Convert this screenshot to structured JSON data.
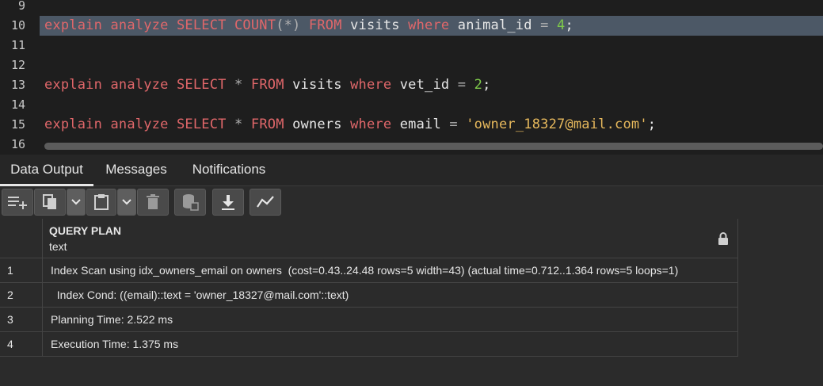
{
  "editor": {
    "lines": [
      {
        "n": "9",
        "tokens": []
      },
      {
        "n": "10",
        "highlighted": true,
        "tokens": [
          {
            "t": "explain analyze SELECT COUNT",
            "c": "kw"
          },
          {
            "t": "(*)",
            "c": "op"
          },
          {
            "t": " FROM ",
            "c": "kw"
          },
          {
            "t": "visits ",
            "c": ""
          },
          {
            "t": "where ",
            "c": "kw"
          },
          {
            "t": "animal_id ",
            "c": ""
          },
          {
            "t": "= ",
            "c": "op"
          },
          {
            "t": "4",
            "c": "num"
          },
          {
            "t": ";",
            "c": ""
          }
        ]
      },
      {
        "n": "11",
        "tokens": []
      },
      {
        "n": "12",
        "tokens": []
      },
      {
        "n": "13",
        "tokens": [
          {
            "t": "explain analyze SELECT ",
            "c": "kw"
          },
          {
            "t": "* ",
            "c": "op"
          },
          {
            "t": "FROM ",
            "c": "kw"
          },
          {
            "t": "visits ",
            "c": ""
          },
          {
            "t": "where ",
            "c": "kw"
          },
          {
            "t": "vet_id ",
            "c": ""
          },
          {
            "t": "= ",
            "c": "op"
          },
          {
            "t": "2",
            "c": "num"
          },
          {
            "t": ";",
            "c": ""
          }
        ]
      },
      {
        "n": "14",
        "tokens": []
      },
      {
        "n": "15",
        "tokens": [
          {
            "t": "explain analyze SELECT ",
            "c": "kw"
          },
          {
            "t": "* ",
            "c": "op"
          },
          {
            "t": "FROM ",
            "c": "kw"
          },
          {
            "t": "owners ",
            "c": ""
          },
          {
            "t": "where ",
            "c": "kw"
          },
          {
            "t": "email ",
            "c": ""
          },
          {
            "t": "= ",
            "c": "op"
          },
          {
            "t": "'owner_18327@mail.com'",
            "c": "str"
          },
          {
            "t": ";",
            "c": ""
          }
        ]
      },
      {
        "n": "16",
        "tokens": []
      }
    ]
  },
  "tabs": [
    {
      "label": "Data Output",
      "active": true
    },
    {
      "label": "Messages",
      "active": false
    },
    {
      "label": "Notifications",
      "active": false
    }
  ],
  "toolbar": {
    "icons": [
      "add-row-icon",
      "copy-icon",
      "chevron-down-icon",
      "paste-icon",
      "chevron-down-icon",
      "delete-icon",
      "save-data-icon",
      "download-icon",
      "graph-icon"
    ]
  },
  "grid": {
    "column": {
      "name": "QUERY PLAN",
      "type": "text"
    },
    "rows": [
      {
        "n": "1",
        "value": "Index Scan using idx_owners_email on owners  (cost=0.43..24.48 rows=5 width=43) (actual time=0.712..1.364 rows=5 loops=1)"
      },
      {
        "n": "2",
        "value": "  Index Cond: ((email)::text = 'owner_18327@mail.com'::text)"
      },
      {
        "n": "3",
        "value": "Planning Time: 2.522 ms"
      },
      {
        "n": "4",
        "value": "Execution Time: 1.375 ms"
      }
    ]
  },
  "colors": {
    "keyword": "#e0676a",
    "number": "#7ec94a",
    "string": "#e6b85c",
    "highlight": "#4c5866"
  }
}
